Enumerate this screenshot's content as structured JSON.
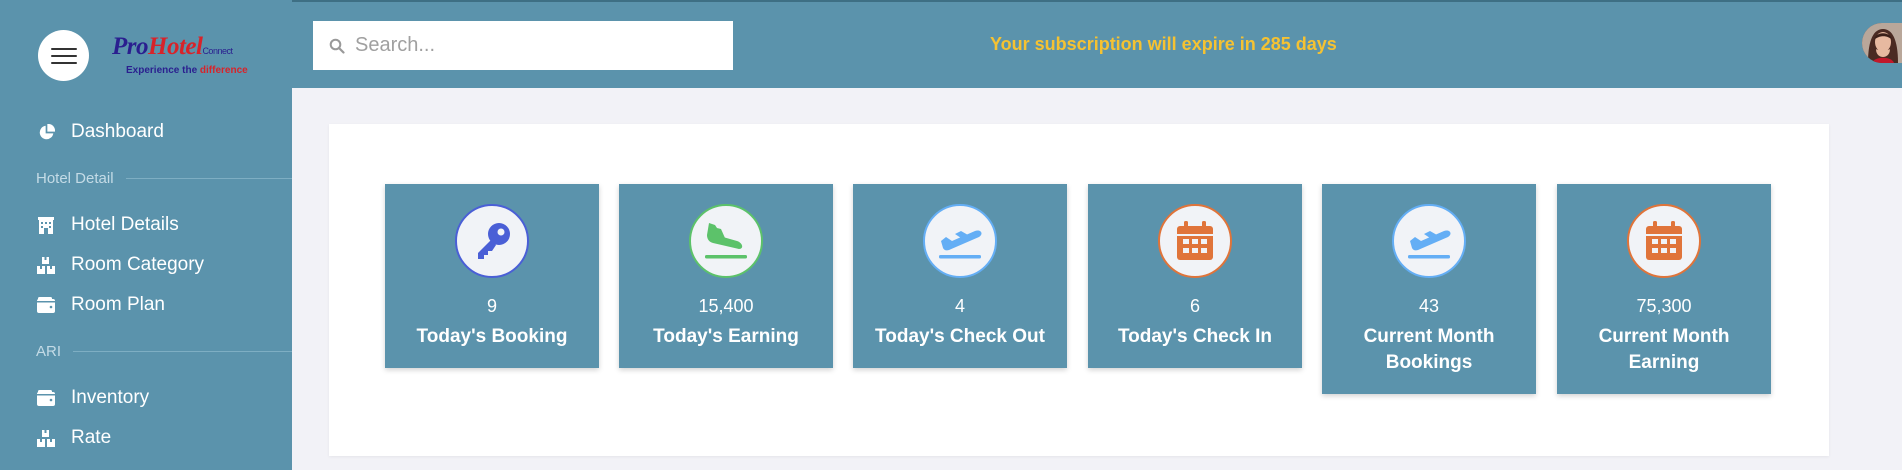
{
  "brand": {
    "name_part1": "Pro",
    "name_part2": "Hotel",
    "name_part3": "Connect",
    "tagline_part1": "Experience the ",
    "tagline_part2": "difference"
  },
  "search": {
    "placeholder": "Search..."
  },
  "subscription_notice": "Your subscription will expire in 285 days",
  "sidebar": {
    "dashboard": {
      "label": "Dashboard",
      "icon": "pie-chart-icon"
    },
    "sections": [
      {
        "title": "Hotel Detail",
        "items": [
          {
            "label": "Hotel Details",
            "icon": "building-icon"
          },
          {
            "label": "Room Category",
            "icon": "boxes-icon"
          },
          {
            "label": "Room Plan",
            "icon": "wallet-icon"
          }
        ]
      },
      {
        "title": "ARI",
        "items": [
          {
            "label": "Inventory",
            "icon": "wallet-icon"
          },
          {
            "label": "Rate",
            "icon": "boxes-icon"
          }
        ]
      }
    ]
  },
  "stats": [
    {
      "value": "9",
      "label": "Today's Booking",
      "icon": "key-icon",
      "color": "#4a5fd6"
    },
    {
      "value": "15,400",
      "label": "Today's Earning",
      "icon": "plane-landing-icon",
      "color": "#5cc26a"
    },
    {
      "value": "4",
      "label": "Today's Check Out",
      "icon": "plane-departure-icon",
      "color": "#64aef5"
    },
    {
      "value": "6",
      "label": "Today's Check In",
      "icon": "calendar-icon",
      "color": "#e0743a"
    },
    {
      "value": "43",
      "label": "Current Month Bookings",
      "icon": "plane-departure-icon",
      "color": "#64aef5"
    },
    {
      "value": "75,300",
      "label": "Current Month Earning",
      "icon": "calendar-icon",
      "color": "#e0743a"
    }
  ]
}
